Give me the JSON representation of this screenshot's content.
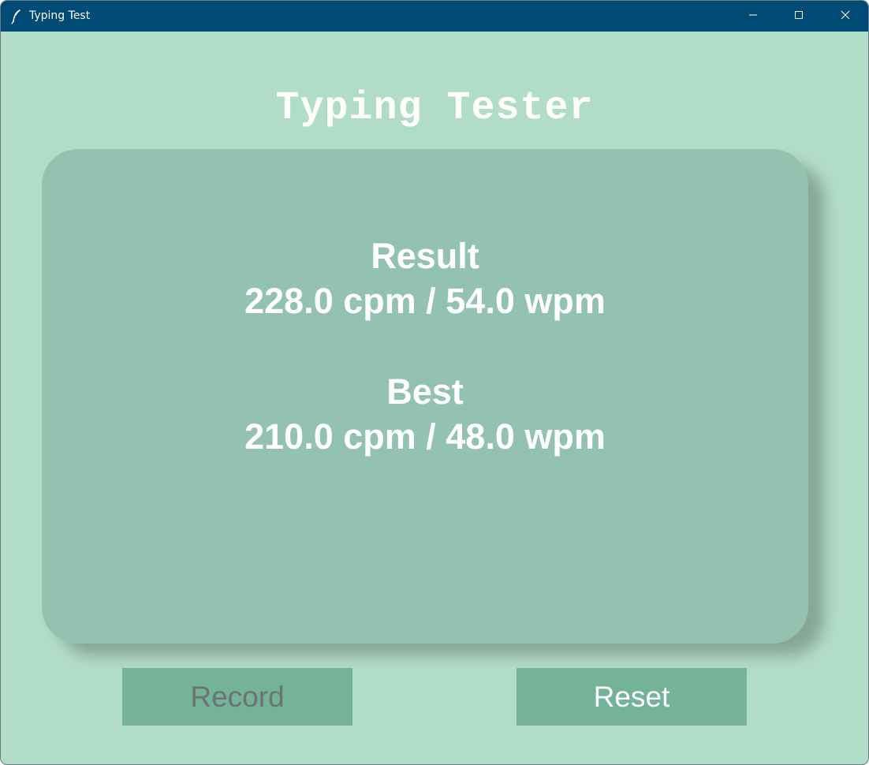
{
  "window": {
    "title": "Typing Test",
    "icon": "feather-icon",
    "controls": [
      "minimize-icon",
      "maximize-icon",
      "close-icon"
    ]
  },
  "heading": "Typing Tester",
  "result": {
    "label": "Result",
    "value": "228.0 cpm / 54.0 wpm"
  },
  "best": {
    "label": "Best",
    "value": "210.0 cpm / 48.0 wpm"
  },
  "buttons": {
    "record": "Record",
    "reset": "Reset"
  },
  "colors": {
    "titlebar": "#004b76",
    "background": "#b1dcc7",
    "card": "#93c2b0",
    "button": "#74b29a",
    "record_text": "#6a7470",
    "text": "#ffffff"
  }
}
